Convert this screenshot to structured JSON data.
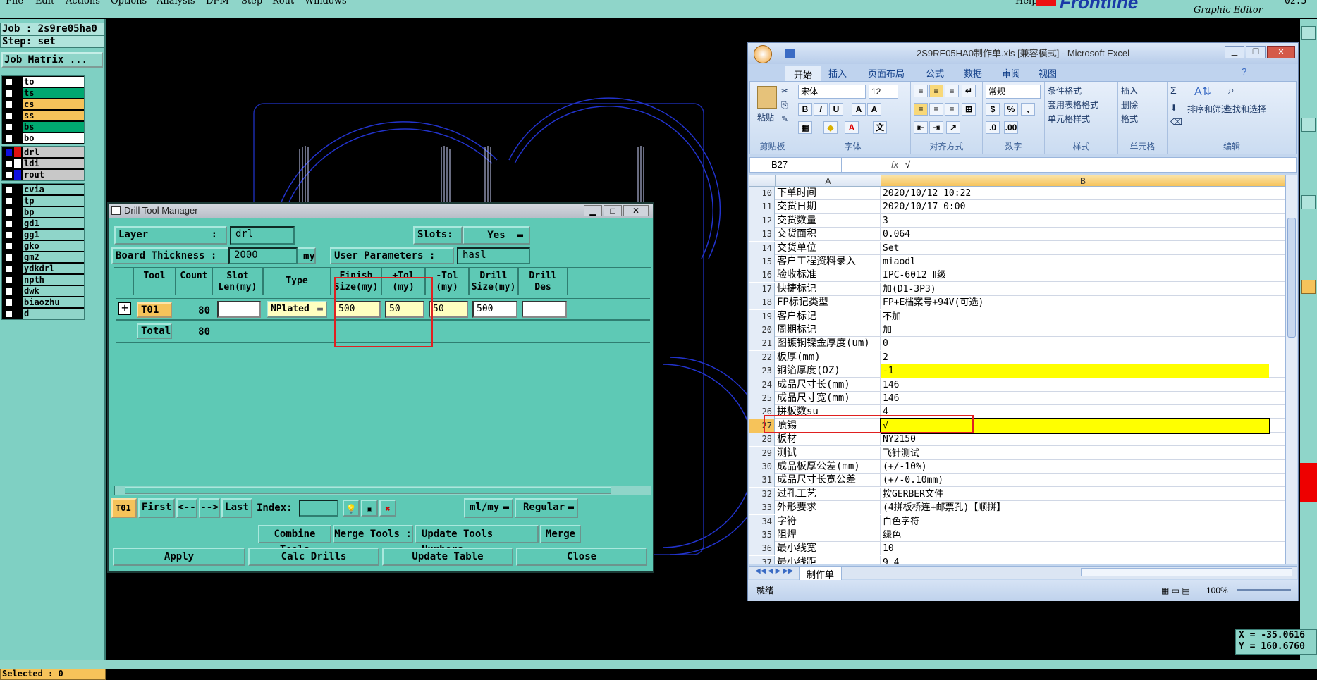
{
  "menubar": {
    "items": [
      "File",
      "Edit",
      "Actions",
      "Options",
      "Analysis",
      "DFM",
      "Step",
      "Rout",
      "Windows",
      "Help"
    ],
    "logo": "Frontline",
    "subtitle": "Graphic Editor",
    "clock": "02:5"
  },
  "left_panel": {
    "job": "Job : 2s9re05ha0",
    "step": "Step: set",
    "job_matrix": "Job Matrix ...",
    "layers_top": [
      {
        "name": "to",
        "color": "#ffffff"
      },
      {
        "name": "ts",
        "color": "#00a870"
      },
      {
        "name": "cs",
        "color": "#f6c35a"
      },
      {
        "name": "ss",
        "color": "#f6c35a"
      },
      {
        "name": "bs",
        "color": "#00a870"
      },
      {
        "name": "bo",
        "color": "#ffffff"
      }
    ],
    "layers_mid": [
      {
        "name": "drl",
        "color": "#c8c8c8",
        "swatch": "#e01010",
        "selected": true
      },
      {
        "name": "ldi",
        "color": "#c8c8c8",
        "swatch": "#ffffff"
      },
      {
        "name": "rout",
        "color": "#c8c8c8",
        "swatch": "#1010e0"
      }
    ],
    "layers_bottom": [
      {
        "name": "cvia"
      },
      {
        "name": "tp"
      },
      {
        "name": "bp"
      },
      {
        "name": "gd1"
      },
      {
        "name": "gg1"
      },
      {
        "name": "gko"
      },
      {
        "name": "gm2"
      },
      {
        "name": "ydkdrl"
      },
      {
        "name": "npth"
      },
      {
        "name": "dwk"
      },
      {
        "name": "biaozhu"
      },
      {
        "name": "d"
      }
    ],
    "selected_text": "Selected : 0"
  },
  "drill_tool_manager": {
    "title": "Drill Tool Manager",
    "layer_label": "Layer",
    "layer_colon": ":",
    "layer_value": "drl",
    "slots_label": "Slots:",
    "slots_value": "Yes",
    "board_thickness_label": "Board Thickness :",
    "board_thickness_value": "2000",
    "board_thickness_unit": "my",
    "user_params_label": "User Parameters :",
    "user_params_value": "hasl",
    "columns": [
      "Tool",
      "Count",
      "Slot Len(my)",
      "Type",
      "Finish Size(my)",
      "+Tol (my)",
      "-Tol (my)",
      "Drill Size(my)",
      "Drill Des"
    ],
    "row": {
      "tool": "T01",
      "count": "80",
      "slot_len": "",
      "type": "NPlated",
      "finish": "500",
      "plus_tol": "50",
      "minus_tol": "50",
      "drill_size": "500",
      "drill_des": ""
    },
    "total_label": "Total",
    "total_count": "80",
    "nav": {
      "current": "T01",
      "first": "First",
      "prev": "<--",
      "next": "-->",
      "last": "Last",
      "index_label": "Index:",
      "units": "ml/my",
      "mode": "Regular"
    },
    "buttons": {
      "combine": "Combine Tools",
      "merge_tools": "Merge Tools :",
      "update_numbers": "Update Tools Numbers",
      "merge": "Merge",
      "apply": "Apply",
      "calc": "Calc Drills",
      "update_table": "Update Table",
      "close": "Close"
    }
  },
  "excel": {
    "title": "2S9RE05HA0制作单.xls  [兼容模式] - Microsoft Excel",
    "tabs": [
      "开始",
      "插入",
      "页面布局",
      "公式",
      "数据",
      "审阅",
      "视图"
    ],
    "groups": [
      "剪贴板",
      "字体",
      "对齐方式",
      "数字",
      "样式",
      "单元格",
      "编辑"
    ],
    "paste": "粘贴",
    "font_name": "宋体",
    "font_size": "12",
    "number_format": "常规",
    "styles": [
      "条件格式",
      "套用表格格式",
      "单元格样式"
    ],
    "cells_grp": [
      "插入",
      "删除",
      "格式"
    ],
    "edit_grp": [
      "排序和筛选",
      "查找和选择"
    ],
    "namebox": "B27",
    "fx": "fx",
    "formula": "√",
    "col_a": "A",
    "col_b": "B",
    "rows": [
      {
        "n": "10",
        "a": "下单时间",
        "b": "2020/10/12 10:22"
      },
      {
        "n": "11",
        "a": "交货日期",
        "b": "2020/10/17 0:00"
      },
      {
        "n": "12",
        "a": "交货数量",
        "b": "3"
      },
      {
        "n": "13",
        "a": "交货面积",
        "b": "0.064"
      },
      {
        "n": "14",
        "a": "交货单位",
        "b": "Set"
      },
      {
        "n": "15",
        "a": "客户工程资料录入",
        "b": "miaodl"
      },
      {
        "n": "16",
        "a": "验收标准",
        "b": "IPC-6012 Ⅱ级"
      },
      {
        "n": "17",
        "a": "快捷标记",
        "b": "加(D1-3P3)"
      },
      {
        "n": "18",
        "a": "FP标记类型",
        "b": "FP+E档案号+94V(可选)"
      },
      {
        "n": "19",
        "a": "客户标记",
        "b": "不加"
      },
      {
        "n": "20",
        "a": "周期标记",
        "b": "加"
      },
      {
        "n": "21",
        "a": "图镀铜镍金厚度(um)",
        "b": "0"
      },
      {
        "n": "22",
        "a": "板厚(mm)",
        "b": "2"
      },
      {
        "n": "23",
        "a": "铜箔厚度(OZ)",
        "b": "-1",
        "hl": true
      },
      {
        "n": "24",
        "a": "成品尺寸长(mm)",
        "b": "146"
      },
      {
        "n": "25",
        "a": "成品尺寸宽(mm)",
        "b": "146"
      },
      {
        "n": "26",
        "a": "拼板数su",
        "b": "4"
      },
      {
        "n": "27",
        "a": "喷锡",
        "b": "√",
        "hl": true,
        "sel": true
      },
      {
        "n": "28",
        "a": "板材",
        "b": "NY2150"
      },
      {
        "n": "29",
        "a": "测试",
        "b": "飞针测试"
      },
      {
        "n": "30",
        "a": "成品板厚公差(mm)",
        "b": "(+/-10%)"
      },
      {
        "n": "31",
        "a": "成品尺寸长宽公差",
        "b": "(+/-0.10mm)"
      },
      {
        "n": "32",
        "a": "过孔工艺",
        "b": "按GERBER文件"
      },
      {
        "n": "33",
        "a": "外形要求",
        "b": "(4拼板桥连+邮票孔)【顺拼】"
      },
      {
        "n": "34",
        "a": "字符",
        "b": "白色字符"
      },
      {
        "n": "35",
        "a": "阻焊",
        "b": "绿色"
      },
      {
        "n": "36",
        "a": "最小线宽",
        "b": "10"
      },
      {
        "n": "37",
        "a": "最小线距",
        "b": "9.4"
      }
    ],
    "sheet_tab": "制作单",
    "status": "就绪",
    "zoom": "100%"
  },
  "coords": {
    "x": "X = -35.0616",
    "y": "Y = 160.6760"
  }
}
